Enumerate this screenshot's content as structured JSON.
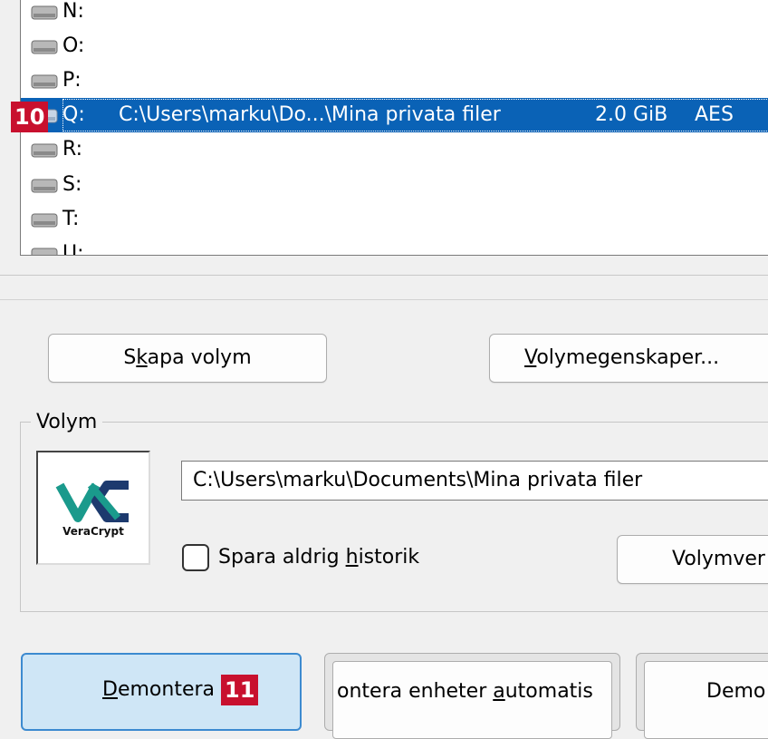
{
  "drive_list": {
    "rows": [
      {
        "letter": "N:",
        "path": "",
        "size": "",
        "algorithm": ""
      },
      {
        "letter": "O:",
        "path": "",
        "size": "",
        "algorithm": ""
      },
      {
        "letter": "P:",
        "path": "",
        "size": "",
        "algorithm": ""
      },
      {
        "letter": "Q:",
        "path": "C:\\Users\\marku\\Do...\\Mina privata filer",
        "size": "2.0 GiB",
        "algorithm": "AES",
        "selected": true
      },
      {
        "letter": "R:",
        "path": "",
        "size": "",
        "algorithm": ""
      },
      {
        "letter": "S:",
        "path": "",
        "size": "",
        "algorithm": ""
      },
      {
        "letter": "T:",
        "path": "",
        "size": "",
        "algorithm": ""
      },
      {
        "letter": "U:",
        "path": "",
        "size": "",
        "algorithm": ""
      }
    ]
  },
  "badges": {
    "step_10": "10",
    "step_11": "11"
  },
  "buttons": {
    "create_volume": {
      "pre": "S",
      "accel": "k",
      "post": "apa volym"
    },
    "volume_properties": {
      "pre": "",
      "accel": "V",
      "post": "olymegenskaper..."
    },
    "volume_tools": "Volymver",
    "dismount": {
      "pre": "",
      "accel": "D",
      "post": "emontera"
    },
    "auto_mount": {
      "pre": "ontera enheter ",
      "accel": "a",
      "post": "utomatis"
    },
    "dismount_all": "Demo"
  },
  "volume_group": {
    "title": "Volym",
    "path_value": "C:\\Users\\marku\\Documents\\Mina privata filer",
    "never_save_history": {
      "pre": "Spara aldrig ",
      "accel": "h",
      "post": "istorik",
      "checked": false
    }
  },
  "logo": {
    "text": "VeraCrypt"
  },
  "colors": {
    "selection": "#0a62b6",
    "badge": "#c8102e",
    "logo_teal": "#1a9a8c",
    "logo_navy": "#1d3a6e"
  }
}
